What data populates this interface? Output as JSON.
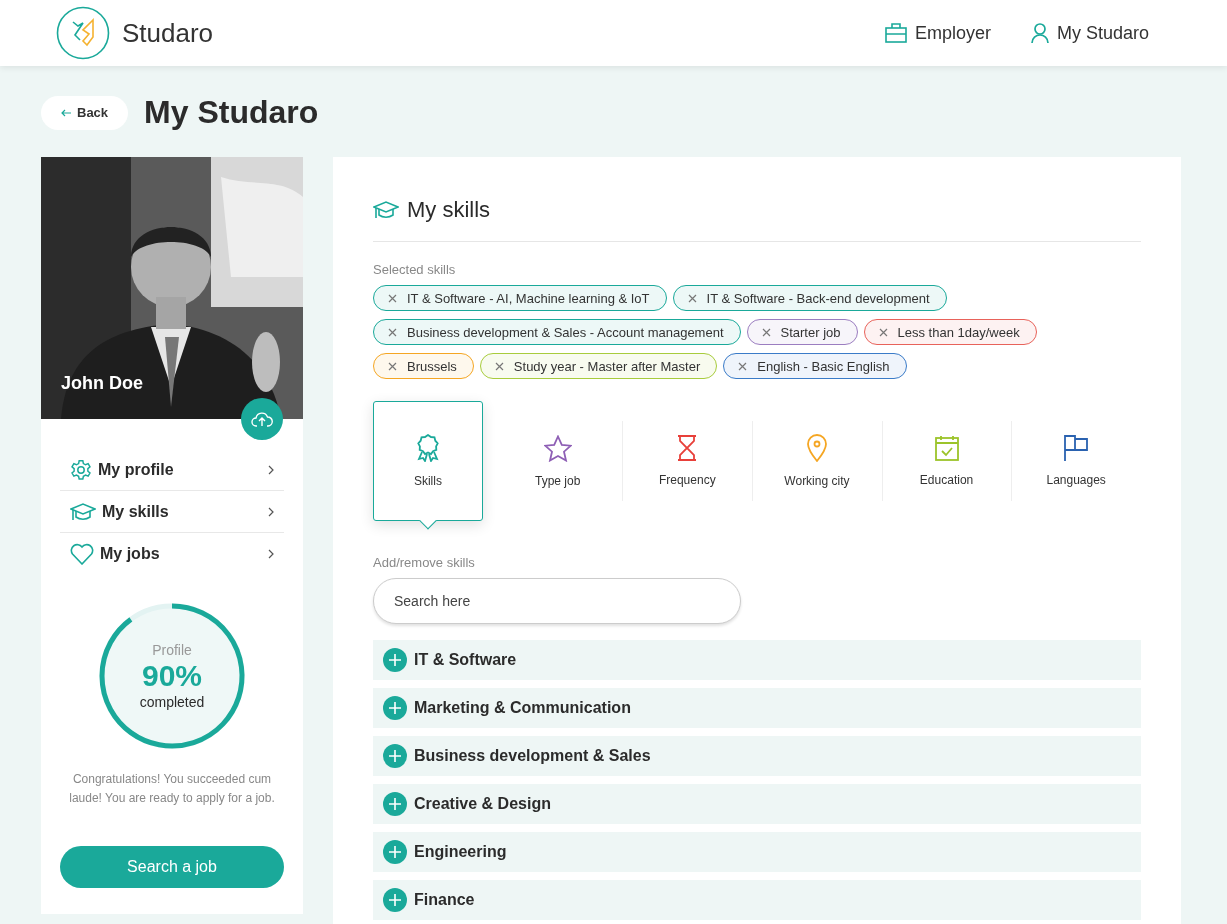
{
  "header": {
    "brand": "Studaro",
    "nav": [
      {
        "label": "Employer",
        "kind": "briefcase"
      },
      {
        "label": "My Studaro",
        "kind": "user"
      }
    ]
  },
  "page": {
    "back": "Back",
    "title": "My Studaro"
  },
  "profile": {
    "name": "John Doe",
    "menu": [
      {
        "label": "My profile",
        "kind": "gear"
      },
      {
        "label": "My skills",
        "kind": "cap"
      },
      {
        "label": "My jobs",
        "kind": "heart"
      }
    ],
    "progress": {
      "label": "Profile",
      "value": "90%",
      "caption": "completed",
      "level": 0.9
    },
    "message": "Congratulations! You succeeded cum laude! You are ready to apply for a job.",
    "cta": "Search a job"
  },
  "skills": {
    "title": "My skills",
    "selected_label": "Selected skills",
    "tags": [
      {
        "label": "IT & Software - AI, Machine learning & IoT",
        "color": "#1aa99a"
      },
      {
        "label": "IT & Software - Back-end development",
        "color": "#1aa99a"
      },
      {
        "label": "Business development & Sales - Account management",
        "color": "#1aa99a"
      },
      {
        "label": "Starter job",
        "color": "#9b7dc0"
      },
      {
        "label": "Less than 1day/week",
        "color": "#e8625a"
      },
      {
        "label": "Brussels",
        "color": "#f5a623"
      },
      {
        "label": "Study year - Master after Master",
        "color": "#a8cc3c"
      },
      {
        "label": "English - Basic English",
        "color": "#3a7bc8"
      }
    ],
    "categories": [
      {
        "label": "Skills",
        "kind": "award",
        "color": "#1aa99a",
        "selected": true
      },
      {
        "label": "Type job",
        "kind": "star",
        "color": "#8e5fb5",
        "selected": false
      },
      {
        "label": "Frequency",
        "kind": "hourglass",
        "color": "#e8403a",
        "selected": false
      },
      {
        "label": "Working city",
        "kind": "pin",
        "color": "#f5a623",
        "selected": false
      },
      {
        "label": "Education",
        "kind": "calendar",
        "color": "#9cc42a",
        "selected": false
      },
      {
        "label": "Languages",
        "kind": "flag",
        "color": "#2a62b0",
        "selected": false
      }
    ],
    "search_label": "Add/remove skills",
    "search_placeholder": "Search here",
    "groups": [
      {
        "label": "IT & Software",
        "expanded": false
      },
      {
        "label": "Marketing & Communication",
        "expanded": false
      },
      {
        "label": "Business development & Sales",
        "expanded": false
      },
      {
        "label": "Creative & Design",
        "expanded": false
      },
      {
        "label": "Engineering",
        "expanded": false
      },
      {
        "label": "Finance",
        "expanded": false
      }
    ]
  }
}
